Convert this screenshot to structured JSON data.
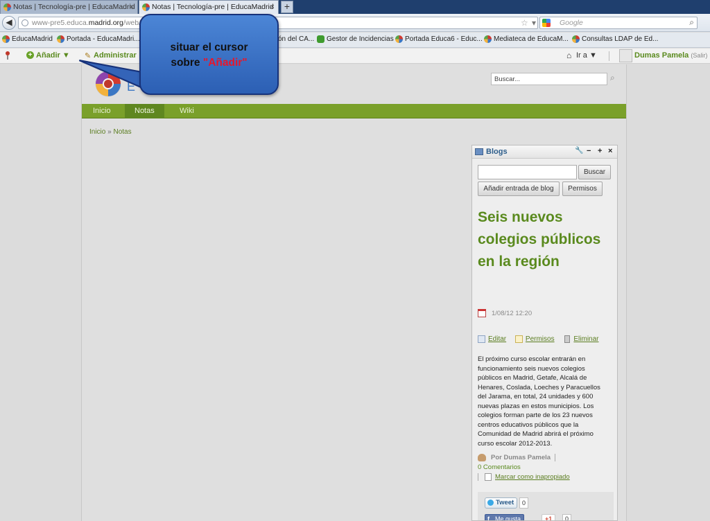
{
  "browser": {
    "tabs": [
      {
        "label": "Notas | Tecnología-pre | EducaMadrid",
        "close": "×"
      },
      {
        "label": "Notas | Tecnología-pre | EducaMadrid",
        "close": "×"
      }
    ],
    "new_tab": "+",
    "url": {
      "prefix": "www-pre5.educa.",
      "domain": "madrid.org",
      "suffix": "/web/t"
    },
    "search_placeholder": "Google"
  },
  "bookmarks": [
    "EducaMadrid",
    "Portada - EducaMadri...",
    "ón del CA...",
    "Gestor de Incidencias",
    "Portada Educa6 - Educ...",
    "Mediateca de EducaM...",
    "Consultas LDAP de Ed..."
  ],
  "dockbar": {
    "add": "Añadir ▼",
    "admin": "Administrar ▼",
    "goto": "Ir a ▼",
    "user_name": "Dumas Pamela",
    "logout": "(Salir)"
  },
  "site": {
    "logo_text": "E",
    "search_placeholder": "Buscar...",
    "nav": [
      "Inicio",
      "Notas",
      "Wiki"
    ],
    "breadcrumb": {
      "home": "Inicio",
      "sep": " » ",
      "current": "Notas"
    }
  },
  "portlet": {
    "title": "Blogs",
    "controls": [
      "🔧",
      "−",
      "+",
      "×"
    ],
    "search_button": "Buscar",
    "add_entry_button": "Añadir entrada de blog",
    "permissions_button": "Permisos",
    "entry": {
      "title": "Seis nuevos colegios públicos en la región",
      "date": "1/08/12 12:20",
      "actions": [
        "Editar",
        "Permisos",
        "Eliminar"
      ],
      "body": "El próximo curso escolar entrarán en funcionamiento seis nuevos colegios públicos en Madrid, Getafe, Alcalá de Henares, Coslada, Loeches y Paracuellos del Jarama, en total, 24 unidades y 600 nuevas plazas en estos municipios. Los colegios forman parte de los 23 nuevos centros educativos públicos que la Comunidad de Madrid abrirá el próximo curso escolar 2012-2013.",
      "author": "Por Dumas Pamela",
      "comments": "0 Comentarios",
      "flag": "Marcar como inapropiado"
    },
    "social": {
      "tweet": "Tweet",
      "tweet_count": "0",
      "fb": "Me gusta",
      "gplus": "+1",
      "gplus_count": "0"
    }
  },
  "callout": {
    "line1": "situar el cursor",
    "line2_prefix": "sobre ",
    "line2_highlight": "\"Añadir\""
  },
  "colors": {
    "accent_green": "#7aa02a",
    "link_green": "#5a8a1e",
    "callout_blue": "#3a72c8",
    "highlight_red": "#e8162a"
  }
}
